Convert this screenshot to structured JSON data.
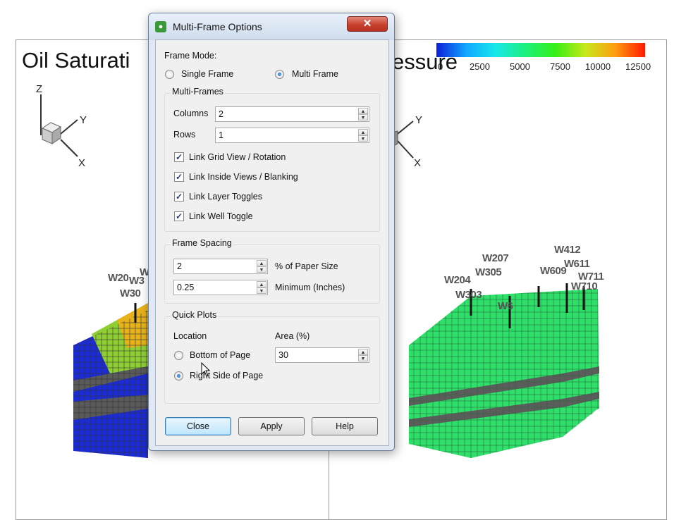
{
  "viewer": {
    "left_title": "Oil Saturati",
    "right_title": "essure",
    "axis": {
      "z": "Z",
      "y": "Y",
      "x": "X"
    },
    "colorbar_labels": [
      "0",
      "2500",
      "5000",
      "7500",
      "10000",
      "12500"
    ],
    "colorbar_colors": [
      "#0b1fd8",
      "#10a8ff",
      "#18e8e8",
      "#1df07a",
      "#36ef16",
      "#c7e81a",
      "#ff9c12",
      "#ff1a00"
    ],
    "left_wells": [
      "W20",
      "W30",
      "W3",
      "W"
    ],
    "right_wells": [
      "W412",
      "W207",
      "W611",
      "W305",
      "W609",
      "W204",
      "W711",
      "W303",
      "W710",
      "W6"
    ]
  },
  "dialog": {
    "title": "Multi-Frame Options",
    "close_glyph": "✕",
    "frame_mode_label": "Frame Mode:",
    "single_frame": "Single Frame",
    "multi_frame": "Multi Frame",
    "selected_mode": "Multi Frame",
    "multi_frames": {
      "title": "Multi-Frames",
      "columns_label": "Columns",
      "columns_value": "2",
      "rows_label": "Rows",
      "rows_value": "1",
      "checks": [
        {
          "label": "Link Grid View / Rotation",
          "checked": true
        },
        {
          "label": "Link Inside Views / Blanking",
          "checked": true
        },
        {
          "label": "Link Layer Toggles",
          "checked": true
        },
        {
          "label": "Link Well Toggle",
          "checked": true
        }
      ]
    },
    "frame_spacing": {
      "title": "Frame Spacing",
      "paper_value": "2",
      "paper_label": "% of Paper Size",
      "min_value": "0.25",
      "min_label": "Minimum (Inches)"
    },
    "quick_plots": {
      "title": "Quick Plots",
      "location_label": "Location",
      "area_label": "Area (%)",
      "area_value": "30",
      "bottom_option": "Bottom of Page",
      "right_option": "Right Side of Page",
      "selected_location": "Right Side of Page"
    },
    "buttons": {
      "close": "Close",
      "apply": "Apply",
      "help": "Help"
    }
  }
}
